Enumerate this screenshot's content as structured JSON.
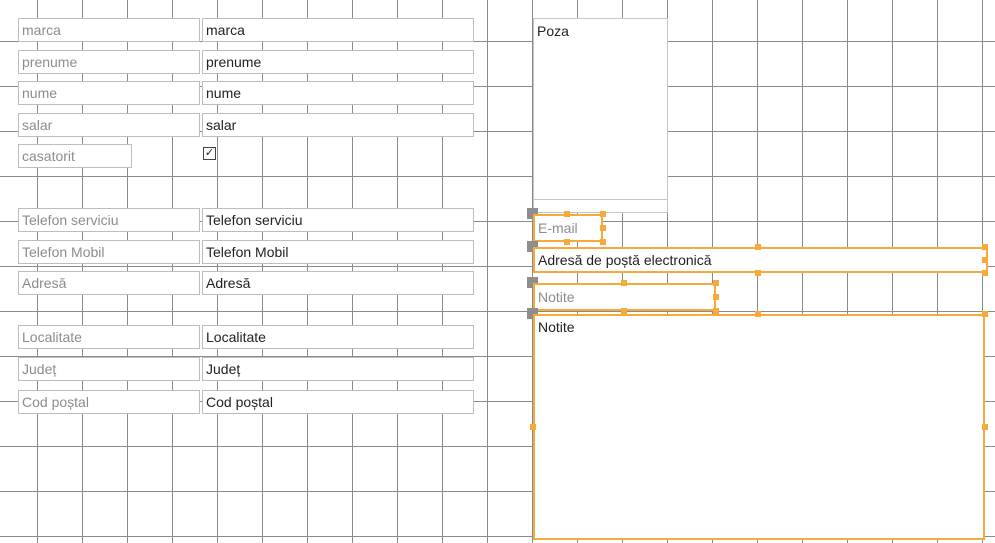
{
  "form": {
    "fields": [
      {
        "label": "marca",
        "value": "marca"
      },
      {
        "label": "prenume",
        "value": "prenume"
      },
      {
        "label": "nume",
        "value": "nume"
      },
      {
        "label": "salar",
        "value": "salar"
      },
      {
        "label": "casatorit",
        "checked": true,
        "check_glyph": "✓"
      },
      {
        "label": "Telefon serviciu",
        "value": "Telefon serviciu"
      },
      {
        "label": "Telefon Mobil",
        "value": "Telefon Mobil"
      },
      {
        "label": "Adresă",
        "value": "Adresă"
      },
      {
        "label": "Localitate",
        "value": "Localitate"
      },
      {
        "label": "Județ",
        "value": "Județ"
      },
      {
        "label": "Cod poștal",
        "value": "Cod poștal"
      }
    ],
    "photo": {
      "label": "Poza"
    },
    "email": {
      "label": "E-mail",
      "value": "Adresă de poștă electronică"
    },
    "notes": {
      "label": "Notite",
      "value": "Notite"
    }
  },
  "colors": {
    "selection": "#f7a93a",
    "grid": "#8a8a8a",
    "label_text": "#8c8c8c"
  }
}
